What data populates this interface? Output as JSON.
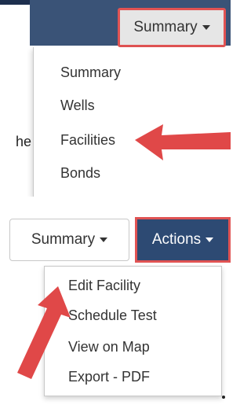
{
  "top_panel": {
    "side_fragment": "he",
    "summary_button_label": "Summary",
    "dropdown_items": [
      "Summary",
      "Wells",
      "Facilities",
      "Bonds"
    ]
  },
  "bottom_panel": {
    "summary_button_label": "Summary",
    "actions_button_label": "Actions",
    "dropdown_items": [
      "Edit Facility",
      "Schedule Test",
      "View on Map",
      "Export - PDF"
    ]
  },
  "colors": {
    "nav_bar": "#3a5377",
    "actions_button": "#2d4a73",
    "highlight_red": "#e05353",
    "arrow_red": "#e04848"
  },
  "icons": [
    "chevron-down-icon",
    "red-arrow-icon"
  ]
}
